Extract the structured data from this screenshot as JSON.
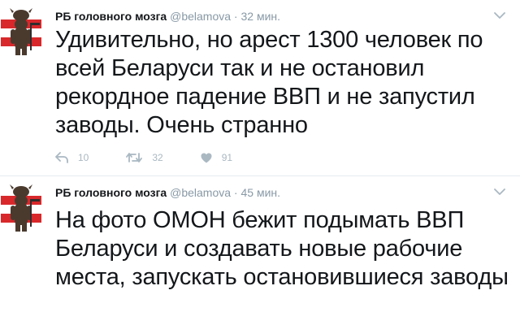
{
  "tweets": [
    {
      "author_name": "РБ головного мозга",
      "handle": "@belamova",
      "separator": "·",
      "time": "32 мин.",
      "text": "Удивительно, но арест 1300 человек по всей Беларуси так и не остановил рекордное падение ВВП и не запустил заводы. Очень странно",
      "replies": "10",
      "retweets": "32",
      "likes": "91"
    },
    {
      "author_name": "РБ головного мозга",
      "handle": "@belamova",
      "separator": "·",
      "time": "45 мин.",
      "text": "На фото ОМОН бежит подымать ВВП Беларуси и создавать новые рабочие места, запускать остановившиеся заводы"
    }
  ],
  "icons": {
    "reply": "reply-icon",
    "retweet": "retweet-icon",
    "like": "heart-icon",
    "more": "chevron-down-icon",
    "avatar": "avatar-bison-flag"
  },
  "colors": {
    "flag_red": "#d8282b",
    "flag_white": "#ffffff",
    "muted": "#8899a6",
    "action_gray": "#aab8c2"
  }
}
